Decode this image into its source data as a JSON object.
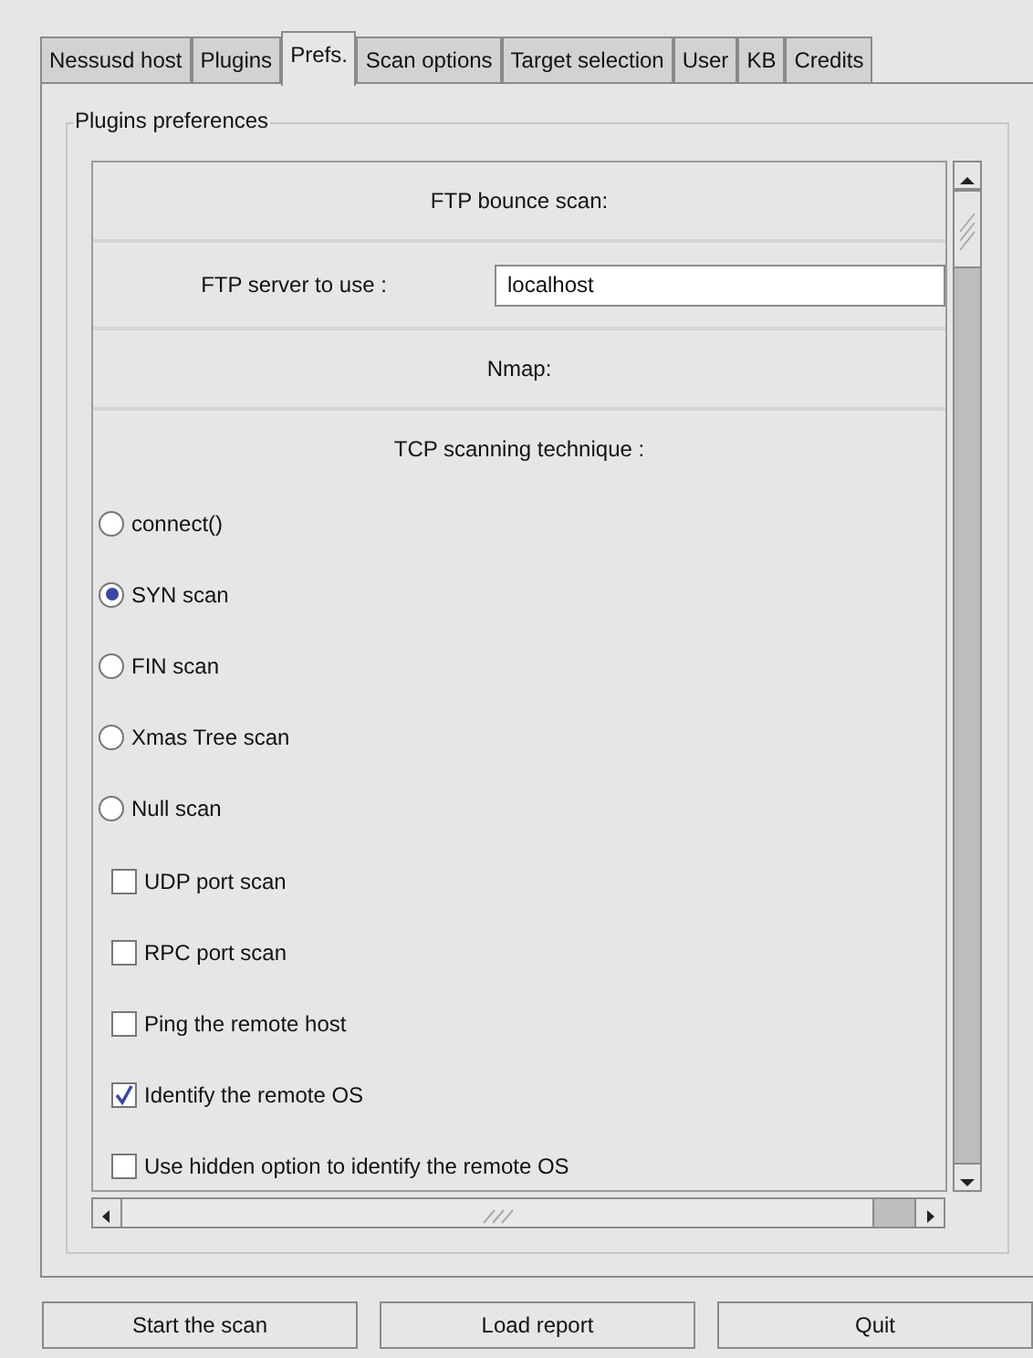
{
  "tabs": [
    {
      "label": "Nessusd host",
      "selected": false
    },
    {
      "label": "Plugins",
      "selected": false
    },
    {
      "label": "Prefs.",
      "selected": true
    },
    {
      "label": "Scan options",
      "selected": false
    },
    {
      "label": "Target selection",
      "selected": false
    },
    {
      "label": "User",
      "selected": false
    },
    {
      "label": "KB",
      "selected": false
    },
    {
      "label": "Credits",
      "selected": false
    }
  ],
  "group": {
    "title": "Plugins preferences"
  },
  "items": [
    {
      "kind": "header",
      "label": "FTP bounce scan:"
    },
    {
      "kind": "field",
      "label": "FTP server to use :",
      "value": "localhost"
    },
    {
      "kind": "header",
      "label": "Nmap:"
    },
    {
      "kind": "caption",
      "label": "TCP scanning technique :"
    },
    {
      "kind": "radio",
      "label": "connect()",
      "selected": false
    },
    {
      "kind": "radio",
      "label": "SYN scan",
      "selected": true
    },
    {
      "kind": "radio",
      "label": "FIN scan",
      "selected": false
    },
    {
      "kind": "radio",
      "label": "Xmas Tree scan",
      "selected": false
    },
    {
      "kind": "radio",
      "label": "Null scan",
      "selected": false
    },
    {
      "kind": "checkbox",
      "label": "UDP port scan",
      "checked": false
    },
    {
      "kind": "checkbox",
      "label": "RPC port scan",
      "checked": false
    },
    {
      "kind": "checkbox",
      "label": "Ping the remote host",
      "checked": false
    },
    {
      "kind": "checkbox",
      "label": "Identify the remote OS",
      "checked": true
    },
    {
      "kind": "checkbox",
      "label": "Use hidden option to identify the remote OS",
      "checked": false
    }
  ],
  "buttons": [
    "Start the scan",
    "Load report",
    "Quit"
  ]
}
